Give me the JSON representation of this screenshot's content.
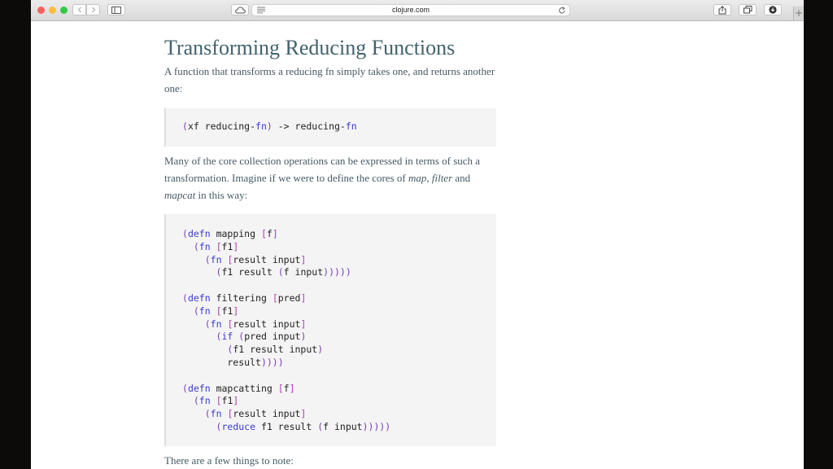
{
  "browser": {
    "url": "clojure.com",
    "new_tab_symbol": "+"
  },
  "article": {
    "heading": "Transforming Reducing Functions",
    "para1": "A function that transforms a reducing fn simply takes one, and returns another one:",
    "code1": [
      [
        {
          "t": "(",
          "c": "par"
        },
        {
          "t": "xf reducing-",
          "c": ""
        },
        {
          "t": "fn",
          "c": "kw"
        },
        {
          "t": ")",
          "c": "par"
        },
        {
          "t": " -> reducing-",
          "c": ""
        },
        {
          "t": "fn",
          "c": "kw"
        }
      ]
    ],
    "para2_before": "Many of the core collection operations can be expressed in terms of such a transformation. Imagine if we were to define the cores of ",
    "para2_map": "map",
    "para2_sep1": ", ",
    "para2_filter": "filter",
    "para2_and": " and ",
    "para2_mapcat": "mapcat",
    "para2_after": " in this way:",
    "code2": [
      [
        {
          "t": "(",
          "c": "par"
        },
        {
          "t": "defn",
          "c": "kw"
        },
        {
          "t": " mapping ",
          "c": ""
        },
        {
          "t": "[",
          "c": "br"
        },
        {
          "t": "f",
          "c": ""
        },
        {
          "t": "]",
          "c": "br"
        }
      ],
      [
        {
          "t": "  ",
          "c": ""
        },
        {
          "t": "(",
          "c": "par"
        },
        {
          "t": "fn",
          "c": "kw"
        },
        {
          "t": " ",
          "c": ""
        },
        {
          "t": "[",
          "c": "br"
        },
        {
          "t": "f1",
          "c": ""
        },
        {
          "t": "]",
          "c": "br"
        }
      ],
      [
        {
          "t": "    ",
          "c": ""
        },
        {
          "t": "(",
          "c": "par"
        },
        {
          "t": "fn",
          "c": "kw"
        },
        {
          "t": " ",
          "c": ""
        },
        {
          "t": "[",
          "c": "br"
        },
        {
          "t": "result input",
          "c": ""
        },
        {
          "t": "]",
          "c": "br"
        }
      ],
      [
        {
          "t": "      ",
          "c": ""
        },
        {
          "t": "(",
          "c": "par"
        },
        {
          "t": "f1 result ",
          "c": ""
        },
        {
          "t": "(",
          "c": "par"
        },
        {
          "t": "f input",
          "c": ""
        },
        {
          "t": ")))))",
          "c": "par"
        }
      ],
      [],
      [
        {
          "t": "(",
          "c": "par"
        },
        {
          "t": "defn",
          "c": "kw"
        },
        {
          "t": " filtering ",
          "c": ""
        },
        {
          "t": "[",
          "c": "br"
        },
        {
          "t": "pred",
          "c": ""
        },
        {
          "t": "]",
          "c": "br"
        }
      ],
      [
        {
          "t": "  ",
          "c": ""
        },
        {
          "t": "(",
          "c": "par"
        },
        {
          "t": "fn",
          "c": "kw"
        },
        {
          "t": " ",
          "c": ""
        },
        {
          "t": "[",
          "c": "br"
        },
        {
          "t": "f1",
          "c": ""
        },
        {
          "t": "]",
          "c": "br"
        }
      ],
      [
        {
          "t": "    ",
          "c": ""
        },
        {
          "t": "(",
          "c": "par"
        },
        {
          "t": "fn",
          "c": "kw"
        },
        {
          "t": " ",
          "c": ""
        },
        {
          "t": "[",
          "c": "br"
        },
        {
          "t": "result input",
          "c": ""
        },
        {
          "t": "]",
          "c": "br"
        }
      ],
      [
        {
          "t": "      ",
          "c": ""
        },
        {
          "t": "(",
          "c": "par"
        },
        {
          "t": "if",
          "c": "kw"
        },
        {
          "t": " ",
          "c": ""
        },
        {
          "t": "(",
          "c": "par"
        },
        {
          "t": "pred input",
          "c": ""
        },
        {
          "t": ")",
          "c": "par"
        }
      ],
      [
        {
          "t": "        ",
          "c": ""
        },
        {
          "t": "(",
          "c": "par"
        },
        {
          "t": "f1 result input",
          "c": ""
        },
        {
          "t": ")",
          "c": "par"
        }
      ],
      [
        {
          "t": "        result",
          "c": ""
        },
        {
          "t": "))))",
          "c": "par"
        }
      ],
      [],
      [
        {
          "t": "(",
          "c": "par"
        },
        {
          "t": "defn",
          "c": "kw"
        },
        {
          "t": " mapcatting ",
          "c": ""
        },
        {
          "t": "[",
          "c": "br"
        },
        {
          "t": "f",
          "c": ""
        },
        {
          "t": "]",
          "c": "br"
        }
      ],
      [
        {
          "t": "  ",
          "c": ""
        },
        {
          "t": "(",
          "c": "par"
        },
        {
          "t": "fn",
          "c": "kw"
        },
        {
          "t": " ",
          "c": ""
        },
        {
          "t": "[",
          "c": "br"
        },
        {
          "t": "f1",
          "c": ""
        },
        {
          "t": "]",
          "c": "br"
        }
      ],
      [
        {
          "t": "    ",
          "c": ""
        },
        {
          "t": "(",
          "c": "par"
        },
        {
          "t": "fn",
          "c": "kw"
        },
        {
          "t": " ",
          "c": ""
        },
        {
          "t": "[",
          "c": "br"
        },
        {
          "t": "result input",
          "c": ""
        },
        {
          "t": "]",
          "c": "br"
        }
      ],
      [
        {
          "t": "      ",
          "c": ""
        },
        {
          "t": "(",
          "c": "par"
        },
        {
          "t": "reduce",
          "c": "kw"
        },
        {
          "t": " f1 result ",
          "c": ""
        },
        {
          "t": "(",
          "c": "par"
        },
        {
          "t": "f input",
          "c": ""
        },
        {
          "t": ")))))",
          "c": "par"
        }
      ]
    ],
    "para3": "There are a few things to note:"
  },
  "theme": {
    "heading_color": "#41626f",
    "text_color": "#455a64",
    "code_background": "#f4f4f4",
    "keyword_color": "#3a3acb",
    "paren_color": "#7b3ab5",
    "bracket_color": "#b33db3"
  }
}
